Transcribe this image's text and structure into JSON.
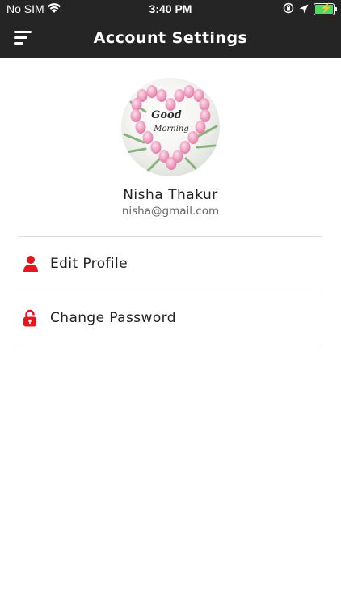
{
  "status_bar": {
    "carrier": "No SIM",
    "time": "3:40 PM"
  },
  "header": {
    "title": "Account Settings",
    "menu_icon": "hamburger-menu-icon"
  },
  "profile": {
    "avatar_image": "Good Morning tulip heart photo",
    "avatar_text_line1": "Good",
    "avatar_text_line2": "Morning",
    "name": "Nisha Thakur",
    "email": "nisha@gmail.com"
  },
  "menu": [
    {
      "label": "Edit Profile",
      "icon": "person-icon"
    },
    {
      "label": "Change Password",
      "icon": "lock-icon"
    }
  ],
  "colors": {
    "header_bg": "#252525",
    "icon_accent": "#e8141e",
    "battery_fill": "#4cd964"
  }
}
